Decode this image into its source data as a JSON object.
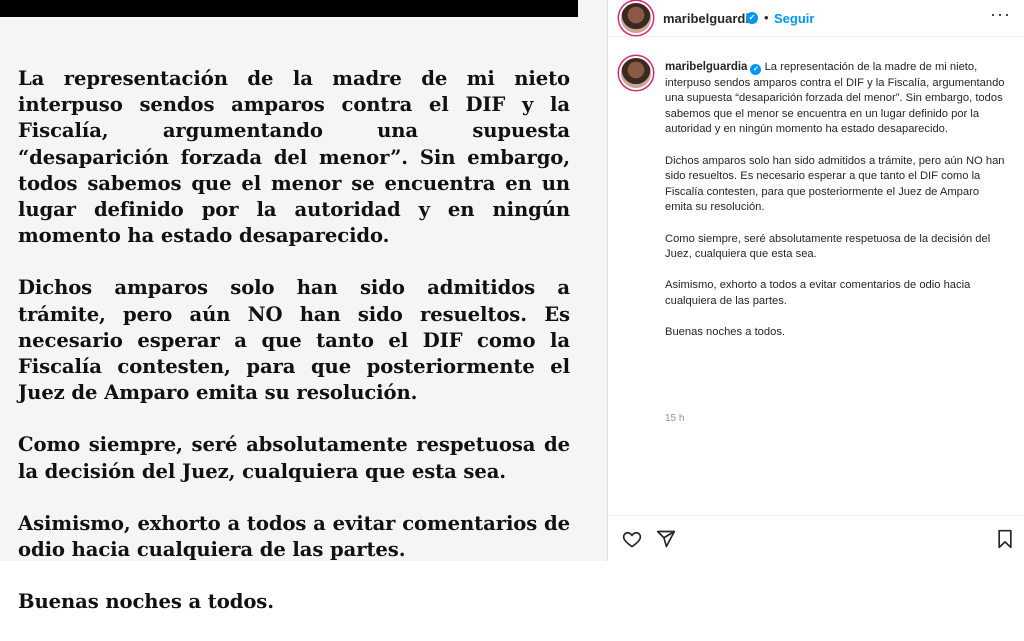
{
  "image": {
    "paragraphs": [
      "La representación de la madre de mi nieto interpuso sendos amparos contra el DIF y la Fiscalía, argumentando una supuesta “desaparición forzada del menor”. Sin embargo, todos sabemos que el menor se encuentra en un lugar definido por la autoridad y en ningún momento ha estado desaparecido.",
      "Dichos amparos solo han sido admitidos a trámite, pero aún NO han sido resueltos. Es necesario esperar a que tanto el DIF como la Fiscalía contesten, para que posteriormente el Juez de Amparo emita su resolución.",
      "Como siempre, seré absolutamente respetuosa de la decisión del Juez, cualquiera que esta sea.",
      "Asimismo, exhorto a todos a evitar comentarios de odio hacia cualquiera de las partes.",
      "Buenas noches a todos."
    ]
  },
  "header": {
    "username": "maribelguardia",
    "separator": "•",
    "follow_label": "Seguir",
    "more_label": "···"
  },
  "caption": {
    "username": "maribelguardia",
    "first": "La representación de la madre de mi nieto, interpuso sendos amparos contra el DIF y la Fiscalía, argumentando una supuesta “desaparición forzada del menor”. Sin embargo, todos sabemos que el menor se encuentra en un lugar definido por la autoridad y en ningún momento ha estado desaparecido.",
    "p2": "Dichos amparos solo han sido admitidos a trámite, pero aún NO han sido resueltos. Es necesario esperar a que tanto el DIF como la Fiscalía contesten, para que posteriormente el Juez de Amparo emita su resolución.",
    "p3": "Como siempre, seré absolutamente respetuosa de la decisión del Juez, cualquiera que esta sea.",
    "p4": "Asimismo, exhorto a todos a evitar comentarios de odio hacia cualquiera de las partes.",
    "p5": "Buenas noches a todos.",
    "timestamp": "15 h"
  },
  "icons": {
    "verified": "verified-badge-icon",
    "like": "heart-icon",
    "share": "paper-plane-icon",
    "save": "bookmark-icon"
  },
  "colors": {
    "accent": "#0095f6",
    "text": "#262626",
    "muted": "#8e8e8e"
  }
}
